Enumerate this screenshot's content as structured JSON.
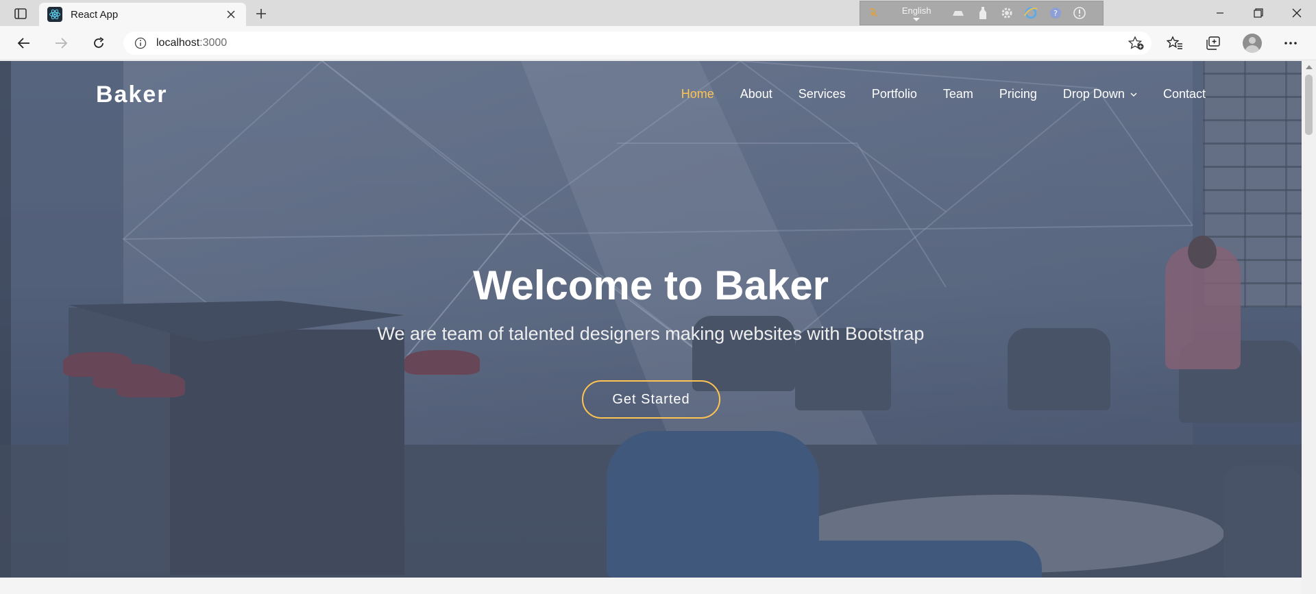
{
  "browser": {
    "tab": {
      "title": "React App",
      "favicon": "react-icon"
    },
    "address": {
      "host": "localhost",
      "port": ":3000"
    },
    "extension": {
      "language": "English"
    },
    "icons": {
      "tab_actions": "tab-actions-icon",
      "close_tab": "close-icon",
      "new_tab": "plus-icon",
      "back": "back-arrow-icon",
      "forward": "forward-arrow-icon",
      "reload": "reload-icon",
      "site_info": "info-icon",
      "add_favorite": "star-add-icon",
      "favorites": "favorites-icon",
      "collections": "collections-icon",
      "profile": "profile-icon",
      "more": "more-icon",
      "minimize": "minimize-icon",
      "restore": "restore-icon",
      "close_window": "close-window-icon"
    }
  },
  "site": {
    "logo": "Baker",
    "nav": [
      {
        "label": "Home",
        "active": true
      },
      {
        "label": "About"
      },
      {
        "label": "Services"
      },
      {
        "label": "Portfolio"
      },
      {
        "label": "Team"
      },
      {
        "label": "Pricing"
      },
      {
        "label": "Drop Down",
        "dropdown": true
      },
      {
        "label": "Contact"
      }
    ],
    "hero": {
      "title": "Welcome to Baker",
      "subtitle": "We are team of talented designers making websites with Bootstrap",
      "cta": "Get Started"
    },
    "colors": {
      "accent": "#ffc451",
      "overlay": "#3e4c68",
      "text": "#ffffff"
    }
  }
}
